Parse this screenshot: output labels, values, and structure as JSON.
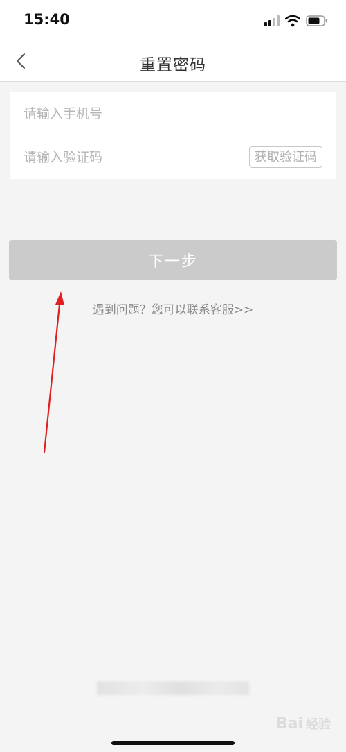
{
  "status_bar": {
    "time": "15:40",
    "icons": [
      "signal-icon",
      "wifi-icon",
      "battery-icon"
    ]
  },
  "nav": {
    "back_icon": "chevron-left-icon",
    "title": "重置密码"
  },
  "form": {
    "phone_placeholder": "请输入手机号",
    "phone_value": "",
    "code_placeholder": "请输入验证码",
    "code_value": "",
    "get_code_label": "获取验证码"
  },
  "next_label": "下一步",
  "help_text": "遇到问题？您可以联系客服>>",
  "watermark": {
    "brand": "Bai",
    "suffix": "经验"
  },
  "colors": {
    "background": "#f4f4f4",
    "card": "#ffffff",
    "next_button_disabled": "#cbcbcb",
    "annotation_arrow": "#e02020"
  }
}
